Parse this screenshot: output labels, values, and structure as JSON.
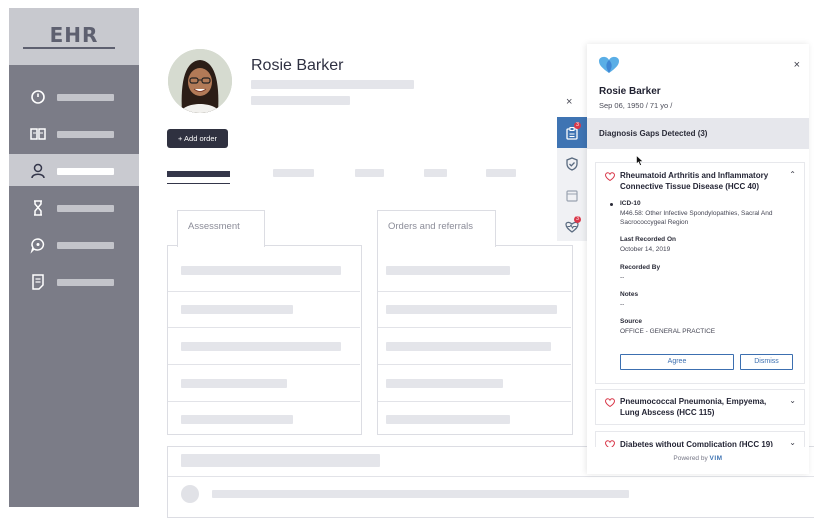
{
  "sidebar": {
    "logo": "EHR",
    "items": [
      {
        "icon": "dashboard-icon",
        "active": false
      },
      {
        "icon": "book-icon",
        "active": false
      },
      {
        "icon": "user-icon",
        "active": true
      },
      {
        "icon": "hourglass-icon",
        "active": false
      },
      {
        "icon": "chat-icon",
        "active": false
      },
      {
        "icon": "document-icon",
        "active": false
      }
    ]
  },
  "patient": {
    "name": "Rosie Barker",
    "add_order": "+ Add order"
  },
  "panels": {
    "assessment": "Assessment",
    "orders": "Orders and referrals"
  },
  "close_symbol": "×",
  "drawer": {
    "patient_name": "Rosie Barker",
    "dob_age": "Sep 06, 1950  /  71 yo  /",
    "gaps_header": "Diagnosis Gaps Detected (3)",
    "expanded": {
      "title": "Rheumatoid Arthritis and Inflammatory Connective Tissue Disease (HCC 40)",
      "code_label": "ICD-10",
      "code_value": "M46.58: Other Infective Spondylopathies, Sacral And Sacrococcygeal Region",
      "last_recorded_label": "Last Recorded On",
      "last_recorded_value": "October 14, 2019",
      "recorded_by_label": "Recorded By",
      "recorded_by_value": "--",
      "notes_label": "Notes",
      "notes_value": "--",
      "source_label": "Source",
      "source_value": "OFFICE - GENERAL PRACTICE",
      "agree": "Agree",
      "dismiss": "Dismiss"
    },
    "collapsed": [
      {
        "title": "Pneumococcal Pneumonia, Empyema, Lung Abscess (HCC 115)"
      },
      {
        "title": "Diabetes without Complication (HCC 19)"
      }
    ],
    "powered_by": "Powered by",
    "brand": "VIM"
  },
  "rail_badges": {
    "first": "3",
    "last": "3"
  },
  "colors": {
    "sidebar": "#7b7c87",
    "accent_blue": "#3f74b3",
    "badge_red": "#d9384a",
    "heart_pink": "#d9384a"
  }
}
